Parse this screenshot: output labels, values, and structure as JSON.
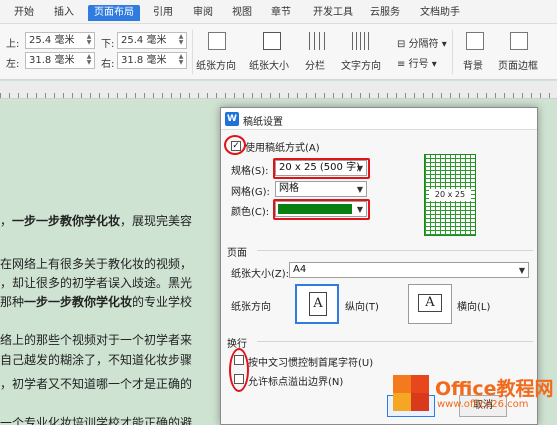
{
  "menu": {
    "tabs": [
      "开始",
      "插入",
      "页面布局",
      "引用",
      "审阅",
      "视图",
      "章节",
      "开发工具",
      "云服务",
      "文档助手"
    ],
    "active_tab": "页面布局"
  },
  "ribbon": {
    "margins": {
      "top_label": "上:",
      "top_value": "25.4 毫米",
      "bottom_label": "下:",
      "bottom_value": "25.4 毫米",
      "left_label": "左:",
      "left_value": "31.8 毫米",
      "right_label": "右:",
      "right_value": "31.8 毫米"
    },
    "buttons": {
      "orientation": "纸张方向",
      "size": "纸张大小",
      "columns": "分栏",
      "text_direction": "文字方向",
      "breaks": "分隔符",
      "line_numbers": "行号",
      "background": "背景",
      "page_border": "页面边框"
    }
  },
  "document": {
    "lines": [
      {
        "pre": "，",
        "bold": "一步一步教你学化妆",
        "post": "，展现完美容"
      },
      {
        "pre": "在网络上有很多关于教化妆的视频，",
        "bold": "",
        "post": ""
      },
      {
        "pre": "，却让很多的初学者误入歧途。黑光",
        "bold": "",
        "post": ""
      },
      {
        "pre": "那种",
        "bold": "一步一步教你学化妆",
        "post": "的专业学校"
      },
      {
        "pre": "络上的那些个视频对于一个初学者来",
        "bold": "",
        "post": ""
      },
      {
        "pre": "自己越发的糊涂了，不知道化妆步骤",
        "bold": "",
        "post": ""
      },
      {
        "pre": "，初学者又不知道哪一个才是正确的",
        "bold": "",
        "post": ""
      },
      {
        "pre": "一个专业化妆培训学校才能正确的避",
        "bold": "",
        "post": ""
      }
    ]
  },
  "dialog": {
    "title": "稿纸设置",
    "use_grid_label": "使用稿纸方式(A)",
    "use_grid_checked": true,
    "spec_label": "规格(S):",
    "spec_value": "20 x 25 (500 字)",
    "grid_label": "网格(G):",
    "grid_value": "网格",
    "color_label": "颜色(C):",
    "color_value": "#0a7f14",
    "preview_label": "20 x 25",
    "page_section": "页面",
    "paper_size_label": "纸张大小(Z):",
    "paper_size_value": "A4",
    "orientation_label": "纸张方向",
    "portrait_label": "纵向(T)",
    "landscape_label": "横向(L)",
    "orientation_glyph": "A",
    "wrap_section": "换行",
    "wrap_option1": "按中文习惯控制首尾字符(U)",
    "wrap_option2": "允许标点溢出边界(N)",
    "ok_label": "确定",
    "cancel_label": "取消"
  },
  "watermark": {
    "title": "Office教程网",
    "url": "www.office26.com"
  },
  "colors": {
    "accent": "#2f7be0",
    "highlight": "#e0121a",
    "grid": "#2d9a2d",
    "brand": "#f26a1b"
  }
}
